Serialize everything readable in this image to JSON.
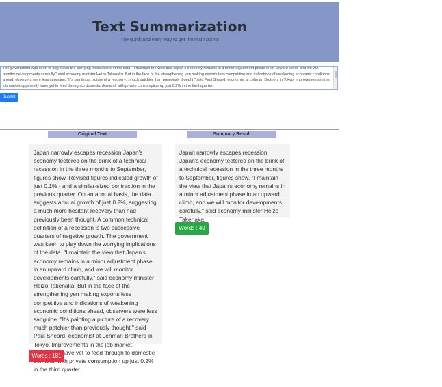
{
  "header": {
    "title": "Text Summarization",
    "subtitle": "The quick and easy way to get the main points"
  },
  "input": {
    "value": "The government was keen to play down the worrying implications of the data. \"I maintain the view that Japan's economy remains in a minor adjustment phase in an upward climb, and we will monitor developments carefully,\" said economy minister Heizo Takenaka. But in the face of the strengthening yen making exports less competitive and indications of weakening economic conditions ahead, observers were less sanguine. \"It's painting a picture of a recovery... much patchier than previously thought,\" said Paul Sheard, economist at Lehman Brothers in Tokyo. Improvements in the job market apparently have yet to feed through to domestic demand, with private consumption up just 0.2% in the third quarter."
  },
  "submit_label": "Submit",
  "original": {
    "label": "Original Text",
    "text": "Japan narrowly escapes recession Japan's economy teetered on the brink of a technical recession in the three months to September, figures show. Revised figures indicated growth of just 0.1% - and a similar-sized contraction in the previous quarter. On an annual basis, the data suggests annual growth of just 0.2%, suggesting a much more hesitant recovery than had previously been thought. A common technical definition of a recession is two successive quarters of negative growth. The government was keen to play down the worrying implications of the data. \"I maintain the view that Japan's economy remains in a minor adjustment phase in an upward climb, and we will monitor developments carefully,\" said economy minister Heizo Takenaka. But in the face of the strengthening yen making exports less competitive and indications of weakening economic conditions ahead, observers were less sanguine. \"It's painting a picture of a recovery... much patchier than previously thought,\" said Paul Sheard, economist at Lehman Brothers in Tokyo. Improvements in the job market apparently have yet to feed through to domestic demand, with private consumption up just 0.2% in the third quarter.",
    "word_count": "Words : 181"
  },
  "summary": {
    "label": "Summary Result",
    "text": "Japan narrowly escapes recession Japan's economy teetered on the brink of a technical recession in the three months to September, figures show. \"I maintain the view that Japan's economy remains in a minor adjustment phase in an upward climb, and we will monitor developments carefully,\" said economy minister Heizo Takenaka.",
    "word_count": "Words : 49"
  },
  "colors": {
    "header_bg": "#8597c6",
    "submit": "#1c7af5",
    "original_badge": "#dc3545",
    "summary_badge": "#28a745"
  }
}
